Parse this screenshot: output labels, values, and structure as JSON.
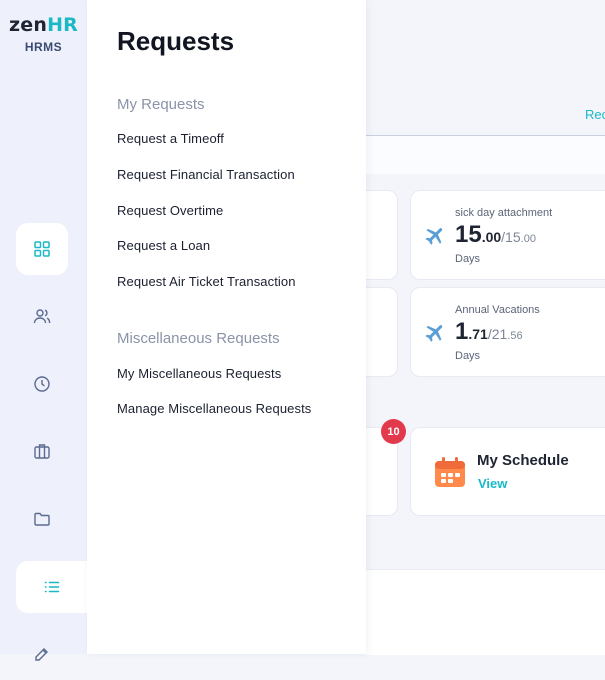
{
  "logo": {
    "brand_a": "zen",
    "brand_b": "HR",
    "sub": "HRMS"
  },
  "rail": {
    "icons": [
      "dashboard-grid-icon",
      "users-icon",
      "clock-icon",
      "briefcase-icon",
      "folder-icon",
      "list-icon",
      "edit-icon"
    ],
    "active": "list-icon"
  },
  "background": {
    "link_fragment": "Rec",
    "cards": [
      {
        "label": "sick day attachment",
        "used": "15",
        "used_dec": ".00",
        "total": "/15",
        "total_dec": ".00",
        "unit": "Days"
      },
      {
        "label": "Annual Vacations",
        "used": "1",
        "used_dec": ".71",
        "total": "/21",
        "total_dec": ".56",
        "unit": "Days"
      }
    ],
    "badge": "10",
    "schedule": {
      "title": "My Schedule",
      "link": "View"
    }
  },
  "panel": {
    "title": "Requests",
    "sections": [
      {
        "heading": "My Requests",
        "items": [
          "Request a Timeoff",
          "Request Financial Transaction",
          "Request Overtime",
          "Request a Loan",
          "Request Air Ticket Transaction"
        ]
      },
      {
        "heading": "Miscellaneous Requests",
        "items": [
          "My Miscellaneous Requests",
          "Manage Miscellaneous Requests"
        ]
      }
    ]
  },
  "colors": {
    "accent": "#19b9c6",
    "badge": "#e23a4c",
    "rail_bg": "#eef0fb",
    "text_dark": "#1b2030",
    "section_gray": "#8a93a8"
  }
}
